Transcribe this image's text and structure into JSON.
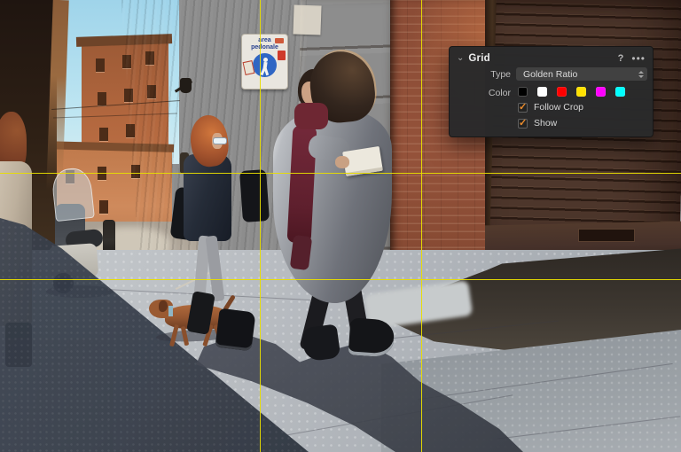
{
  "photo": {
    "sign": {
      "line1": "area",
      "line2": "pedonale"
    }
  },
  "grid_overlay": {
    "type": "Golden Ratio",
    "color": "#e8dd00",
    "vertical_positions_pct": [
      38.2,
      61.8
    ],
    "horizontal_positions_pct": [
      38.2,
      61.8
    ]
  },
  "grid_panel": {
    "title": "Grid",
    "collapse_glyph": "⌄",
    "help_glyph": "?",
    "more_glyph": "•••",
    "type_label": "Type",
    "type_value": "Golden Ratio",
    "color_label": "Color",
    "swatches": [
      "#000000",
      "#ffffff",
      "#ff0000",
      "#ffe100",
      "#ff00ff",
      "#00ffff"
    ],
    "selected_swatch": "#ffe100",
    "check_glyph": "✓",
    "accent_color": "#e98b2d",
    "checkboxes": [
      {
        "label": "Follow Crop",
        "checked": true
      },
      {
        "label": "Show",
        "checked": true
      }
    ]
  }
}
